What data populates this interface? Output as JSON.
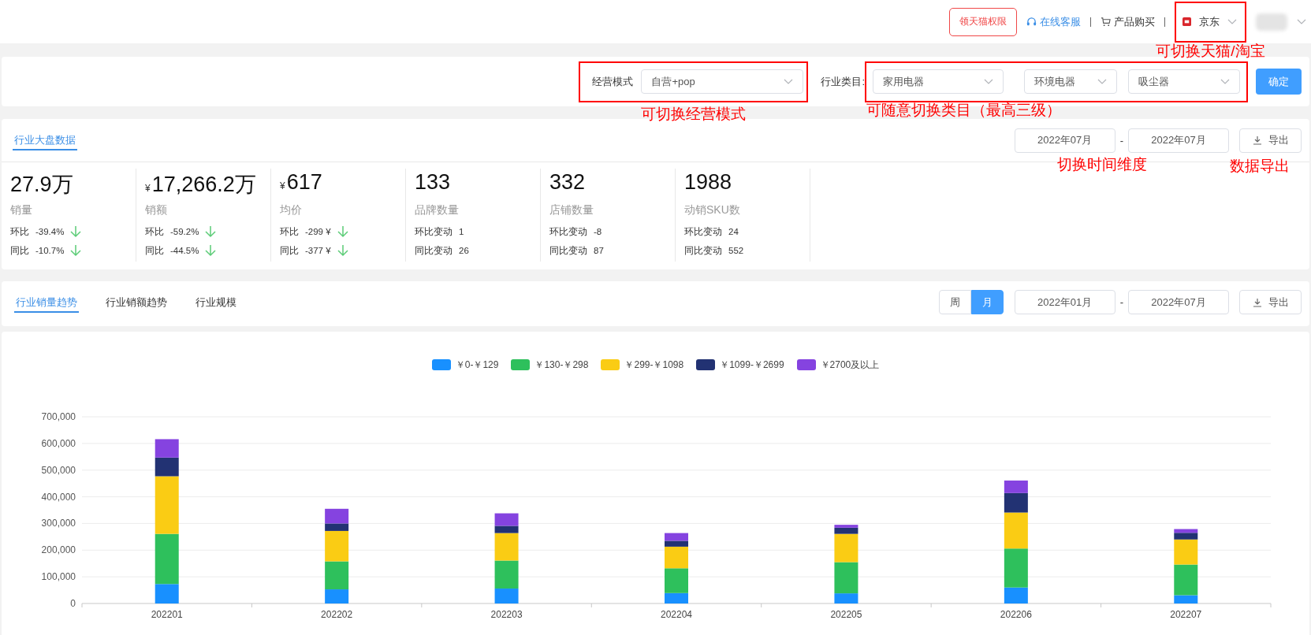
{
  "header": {
    "permission_tag": "领天猫权限",
    "service_link": "在线客服",
    "purchase_link": "产品购买",
    "platform_select": {
      "value": "京东",
      "highlighted": true,
      "annotation": "可切换天猫/淘宝"
    }
  },
  "filter_bar": {
    "mode": {
      "label": "经营模式",
      "value": "自营+pop",
      "highlighted": true,
      "annotation": "可切换经营模式"
    },
    "category": {
      "label": "行业类目:",
      "levels": [
        "家用电器",
        "环境电器",
        "吸尘器"
      ],
      "highlighted": true,
      "annotation": "可随意切换类目（最高三级）"
    },
    "confirm_button": "确定"
  },
  "overview": {
    "tab": {
      "label": "行业大盘数据",
      "selected": true
    },
    "date_from": "2022年07月",
    "separator": "-",
    "date_to": "2022年07月",
    "date_annotation": "切换时间维度",
    "export_button": "导出",
    "export_annotation": "数据导出",
    "kpis": [
      {
        "value": "27.9万",
        "label": "销量",
        "changes": [
          {
            "label": "环比",
            "value": "-39.4%",
            "decreased": true
          },
          {
            "label": "同比",
            "value": "-10.7%",
            "decreased": true
          }
        ]
      },
      {
        "prefix": "¥",
        "value": "17,266.2万",
        "label": "销额",
        "changes": [
          {
            "label": "环比",
            "value": "-59.2%",
            "decreased": true
          },
          {
            "label": "同比",
            "value": "-44.5%",
            "decreased": true
          }
        ]
      },
      {
        "prefix": "¥",
        "value": "617",
        "label": "均价",
        "changes": [
          {
            "label": "环比",
            "value": "-299 ¥",
            "decreased": true
          },
          {
            "label": "同比",
            "value": "-377 ¥",
            "decreased": true
          }
        ]
      },
      {
        "value": "133",
        "label": "品牌数量",
        "changes": [
          {
            "label": "环比变动",
            "value": "1"
          },
          {
            "label": "同比变动",
            "value": "26"
          }
        ]
      },
      {
        "value": "332",
        "label": "店铺数量",
        "changes": [
          {
            "label": "环比变动",
            "value": "-8"
          },
          {
            "label": "同比变动",
            "value": "87"
          }
        ]
      },
      {
        "value": "1988",
        "label": "动销SKU数",
        "changes": [
          {
            "label": "环比变动",
            "value": "24"
          },
          {
            "label": "同比变动",
            "value": "552"
          }
        ]
      }
    ]
  },
  "trend": {
    "tabs": [
      {
        "label": "行业销量趋势",
        "selected": true
      },
      {
        "label": "行业销额趋势",
        "selected": false
      },
      {
        "label": "行业规模",
        "selected": false
      }
    ],
    "granularity": [
      {
        "label": "周",
        "selected": false
      },
      {
        "label": "月",
        "selected": true
      }
    ],
    "date_from": "2022年01月",
    "separator": "-",
    "date_to": "2022年07月",
    "export_button": "导出",
    "chart_data": {
      "type": "bar",
      "stacked": true,
      "grid": true,
      "categories": [
        "202201",
        "202202",
        "202203",
        "202204",
        "202205",
        "202206",
        "202207"
      ],
      "series": [
        {
          "name": "￥0-￥129",
          "color": "#1890ff",
          "values": [
            73000,
            53000,
            56000,
            39000,
            38000,
            60000,
            31000
          ]
        },
        {
          "name": "￥130-￥298",
          "color": "#2ec05c",
          "values": [
            188000,
            105000,
            105000,
            93000,
            117000,
            146000,
            115000
          ]
        },
        {
          "name": "￥299-￥1098",
          "color": "#facc14",
          "values": [
            216000,
            114000,
            103000,
            81000,
            106000,
            135000,
            94000
          ]
        },
        {
          "name": "￥1099-￥2699",
          "color": "#223273",
          "values": [
            70000,
            28000,
            27000,
            22000,
            23000,
            73000,
            25000
          ]
        },
        {
          "name": "￥2700及以上",
          "color": "#8543e0",
          "values": [
            69000,
            55000,
            47000,
            29000,
            11000,
            47000,
            14000
          ]
        }
      ],
      "ylim": [
        0,
        700000
      ],
      "yticks": [
        {
          "value": 0,
          "label": "0"
        },
        {
          "value": 100000,
          "label": "100,000"
        },
        {
          "value": 200000,
          "label": "200,000"
        },
        {
          "value": 300000,
          "label": "300,000"
        },
        {
          "value": 400000,
          "label": "400,000"
        },
        {
          "value": 500000,
          "label": "500,000"
        },
        {
          "value": 600000,
          "label": "600,000"
        },
        {
          "value": 700000,
          "label": "700,000"
        }
      ]
    }
  }
}
